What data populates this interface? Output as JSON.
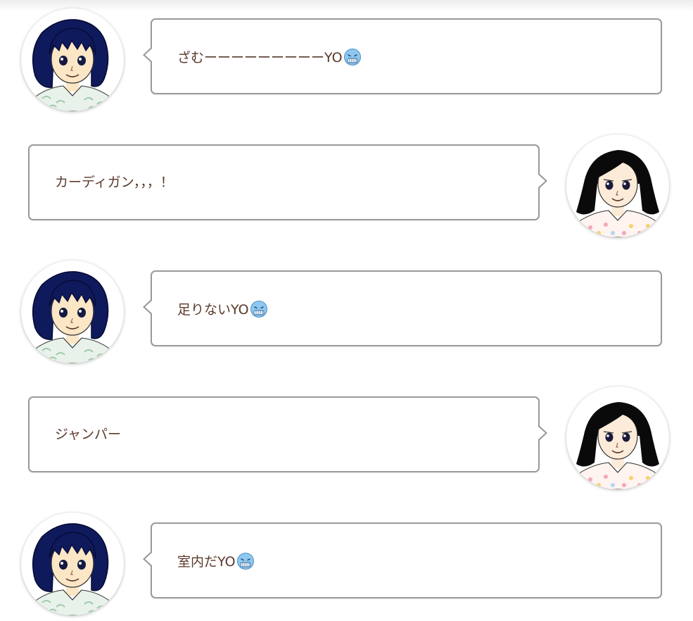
{
  "colors": {
    "bubble_border": "#9a9a9a",
    "text": "#5a3a2a",
    "avatar_a_hair": "#0f1a5c",
    "avatar_b_hair": "#0a0a0a",
    "skin": "#fbe6c6",
    "emoji_face": "#8ec8f0"
  },
  "avatars": {
    "a": {
      "icon": "woman-navy-hair-avatar-icon"
    },
    "b": {
      "icon": "woman-black-hair-avatar-icon"
    }
  },
  "messages": [
    {
      "side": "left",
      "avatar": "a",
      "text": "ざむーーーーーーーーーYO",
      "emoji": "cold-face-emoji-icon"
    },
    {
      "side": "right",
      "avatar": "b",
      "text": "カーディガン，，，！",
      "emoji": ""
    },
    {
      "side": "left",
      "avatar": "a",
      "text": "足りないYO",
      "emoji": "cold-face-emoji-icon"
    },
    {
      "side": "right",
      "avatar": "b",
      "text": "ジャンパー",
      "emoji": ""
    },
    {
      "side": "left",
      "avatar": "a",
      "text": "室内だYO",
      "emoji": "cold-face-emoji-icon"
    }
  ]
}
